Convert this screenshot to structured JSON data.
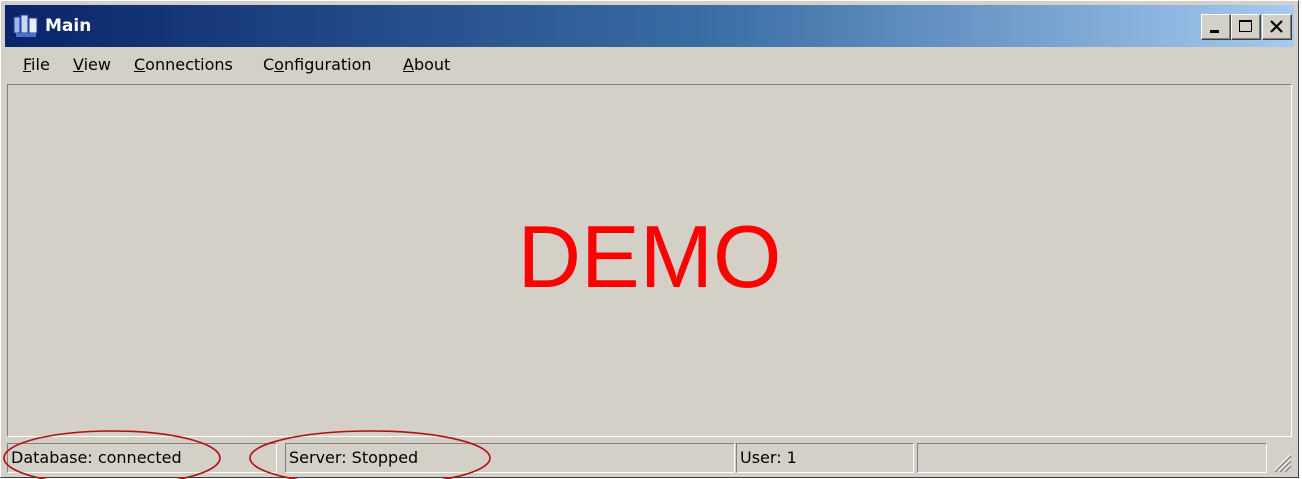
{
  "window": {
    "title": "Main",
    "icon": "app-icon",
    "caption_buttons": [
      "minimize-icon",
      "maximize-icon",
      "close-icon"
    ]
  },
  "menu": {
    "items": [
      {
        "accel": "F",
        "rest": "ile"
      },
      {
        "accel": "V",
        "rest": "iew"
      },
      {
        "accel": "C",
        "rest": "onnections"
      },
      {
        "pre": "C",
        "accel": "o",
        "rest": "nfiguration"
      },
      {
        "accel": "A",
        "rest": "bout"
      }
    ]
  },
  "main": {
    "watermark": "DEMO",
    "watermark_color": "#ff0000"
  },
  "status": {
    "database": "Database: connected",
    "server": "Server: Stopped",
    "user": "User: 1",
    "extra": ""
  },
  "annotations": {
    "ellipse_color": "#b01010",
    "circled": [
      "Database: connected",
      "Server: Stopped"
    ]
  },
  "colors": {
    "face": "#d4d0c8",
    "title_start": "#0a246a",
    "title_end": "#a6caf0"
  }
}
